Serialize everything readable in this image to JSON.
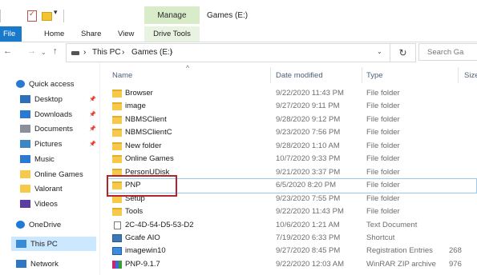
{
  "title_bar": {
    "qa_dropdown_glyph": "▾",
    "manage_tab": "Manage",
    "window_title": "Games (E:)"
  },
  "ribbon": {
    "tabs": [
      "File",
      "Home",
      "Share",
      "View",
      "Drive Tools"
    ]
  },
  "address_bar": {
    "back": "←",
    "forward": "→",
    "recent": "⌄",
    "up": "↑",
    "separator": "›",
    "crumbs": [
      "This PC",
      "Games (E:)"
    ],
    "dropdown": "⌄",
    "refresh": "↻",
    "search_placeholder": "Search Ga"
  },
  "sidebar": {
    "items": [
      {
        "label": "Quick access",
        "icon": "star-icon"
      },
      {
        "label": "Desktop",
        "icon": "desktop-icon",
        "pinned": true
      },
      {
        "label": "Downloads",
        "icon": "download-arrow-icon",
        "pinned": true
      },
      {
        "label": "Documents",
        "icon": "documents-icon",
        "pinned": true
      },
      {
        "label": "Pictures",
        "icon": "pictures-icon",
        "pinned": true
      },
      {
        "label": "Music",
        "icon": "music-note-icon"
      },
      {
        "label": "Online Games",
        "icon": "folder-icon"
      },
      {
        "label": "Valorant",
        "icon": "folder-icon"
      },
      {
        "label": "Videos",
        "icon": "videos-icon"
      },
      {
        "label": "OneDrive",
        "icon": "cloud-icon"
      },
      {
        "label": "This PC",
        "icon": "computer-icon",
        "selected": true
      },
      {
        "label": "Network",
        "icon": "network-icon"
      }
    ],
    "pin_glyph": "📌"
  },
  "columns": {
    "name": "Name",
    "date": "Date modified",
    "type": "Type",
    "size": "Size",
    "sort_glyph": "^"
  },
  "files": [
    {
      "name": "Browser",
      "date": "9/22/2020 11:43 PM",
      "type": "File folder",
      "size": "",
      "icon": "folder"
    },
    {
      "name": "image",
      "date": "9/27/2020 9:11 PM",
      "type": "File folder",
      "size": "",
      "icon": "folder"
    },
    {
      "name": "NBMSClient",
      "date": "9/28/2020 9:12 PM",
      "type": "File folder",
      "size": "",
      "icon": "folder"
    },
    {
      "name": "NBMSClientC",
      "date": "9/23/2020 7:56 PM",
      "type": "File folder",
      "size": "",
      "icon": "folder"
    },
    {
      "name": "New folder",
      "date": "9/28/2020 1:10 AM",
      "type": "File folder",
      "size": "",
      "icon": "folder"
    },
    {
      "name": "Online Games",
      "date": "10/7/2020 9:33 PM",
      "type": "File folder",
      "size": "",
      "icon": "folder"
    },
    {
      "name": "PersonUDisk",
      "date": "9/21/2020 3:37 PM",
      "type": "File folder",
      "size": "",
      "icon": "folder"
    },
    {
      "name": "PNP",
      "date": "6/5/2020 8:20 PM",
      "type": "File folder",
      "size": "",
      "icon": "folder",
      "highlighted": true
    },
    {
      "name": "Setup",
      "date": "9/23/2020 7:55 PM",
      "type": "File folder",
      "size": "",
      "icon": "folder"
    },
    {
      "name": "Tools",
      "date": "9/22/2020 11:43 PM",
      "type": "File folder",
      "size": "",
      "icon": "folder"
    },
    {
      "name": "2C-4D-54-D5-53-D2",
      "date": "10/6/2020 1:21 AM",
      "type": "Text Document",
      "size": "",
      "icon": "doc"
    },
    {
      "name": "Gcafe AIO",
      "date": "7/19/2020 6:33 PM",
      "type": "Shortcut",
      "size": "",
      "icon": "shortcut"
    },
    {
      "name": "imagewin10",
      "date": "9/27/2020 8:45 PM",
      "type": "Registration Entries",
      "size": "268",
      "icon": "reg"
    },
    {
      "name": "PNP-9.1.7",
      "date": "9/22/2020 12:03 AM",
      "type": "WinRAR ZIP archive",
      "size": "976",
      "icon": "zip"
    }
  ],
  "colors": {
    "file_tab": "#1979ca",
    "manage_tab": "#d8ecc9",
    "selected_nav": "#cce8ff",
    "annotation_box": "#b3242d"
  }
}
